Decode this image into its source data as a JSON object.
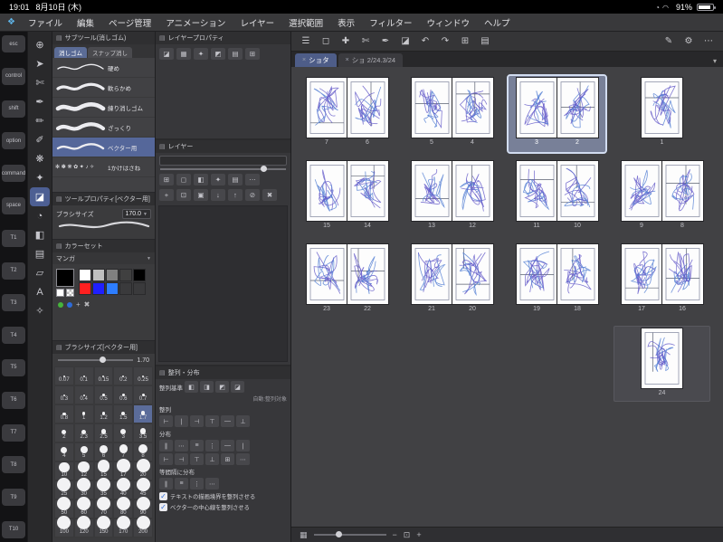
{
  "status_bar": {
    "time": "19:01",
    "date": "8月10日 (木)",
    "battery": "91%",
    "icons": [
      {
        "name": "rotation-lock-icon",
        "glyph": "◔"
      },
      {
        "name": "wifi-icon",
        "glyph": "◠"
      }
    ]
  },
  "menu": {
    "logo": "❖",
    "items": [
      "ファイル",
      "編集",
      "ページ管理",
      "アニメーション",
      "レイヤー",
      "選択範囲",
      "表示",
      "フィルター",
      "ウィンドウ",
      "ヘルプ"
    ]
  },
  "left_rail": {
    "keys": [
      "esc",
      "control",
      "shift",
      "option",
      "command",
      "space",
      "T1",
      "T2",
      "T3",
      "T4",
      "T5",
      "T6",
      "T7",
      "T8",
      "T9",
      "T10"
    ]
  },
  "toolbar": {
    "tools": [
      {
        "name": "zoom",
        "glyph": "⊕"
      },
      {
        "name": "operation",
        "glyph": "➤"
      },
      {
        "name": "lasso",
        "glyph": "✄"
      },
      {
        "name": "pen",
        "glyph": "✒"
      },
      {
        "name": "pencil",
        "glyph": "✏"
      },
      {
        "name": "brush",
        "glyph": "✐"
      },
      {
        "name": "airbrush",
        "glyph": "❋"
      },
      {
        "name": "decoration",
        "glyph": "✦"
      },
      {
        "name": "eraser",
        "glyph": "◪",
        "selected": true
      },
      {
        "name": "blend",
        "glyph": "◔"
      },
      {
        "name": "fill",
        "glyph": "◧"
      },
      {
        "name": "gradient",
        "glyph": "▤"
      },
      {
        "name": "figure",
        "glyph": "▱"
      },
      {
        "name": "text",
        "glyph": "A"
      },
      {
        "name": "eyedropper",
        "glyph": "✧"
      }
    ]
  },
  "subtool": {
    "title": "サブツール(消しゴム)",
    "tabs": [
      {
        "label": "消しゴム",
        "active": true
      },
      {
        "label": "スナップ消し",
        "active": false
      }
    ],
    "items": [
      {
        "label": "硬め"
      },
      {
        "label": "軟らかめ"
      },
      {
        "label": "練り消しゴム"
      },
      {
        "label": "ざっくり"
      },
      {
        "label": "ベクター用",
        "selected": true
      },
      {
        "label": "1かけはさね",
        "deco": true,
        "deco_glyphs": "✻ ✽ ❋ ✿ ✦ ♪ ✧"
      }
    ]
  },
  "tool_property": {
    "title": "ツールプロパティ[ベクター用]",
    "prop_label": "ブラシサイズ",
    "prop_value": "170.0"
  },
  "color_set": {
    "title": "カラーセット",
    "preset": "マンガ",
    "swatch_rows": [
      [
        "#ffffff",
        "#bfbfbf",
        "#808080",
        "#404040",
        "#000000"
      ],
      [
        "#ff2020",
        "#2020ff",
        "#2d7dff",
        "#3a3a3c",
        "#3a3a3c"
      ]
    ],
    "dots": [
      "#46b43c",
      "#2d6bd8"
    ],
    "current_main": "#000000",
    "current_sub": "#ffffff"
  },
  "brush_size": {
    "title": "ブラシサイズ[ベクター用]",
    "value": "1.70",
    "selected": "1.7",
    "rows": [
      [
        "0.07",
        "0.1",
        "0.15",
        "0.2",
        "0.25"
      ],
      [
        "0.3",
        "0.4",
        "0.5",
        "0.6",
        "0.7"
      ],
      [
        "0.8",
        "1",
        "1.2",
        "1.5",
        "1.7"
      ],
      [
        "2",
        "2.3",
        "2.5",
        "3",
        "3.5"
      ],
      [
        "4",
        "5",
        "6",
        "7",
        "8"
      ],
      [
        "10",
        "12",
        "15",
        "17",
        "20"
      ],
      [
        "25",
        "30",
        "35",
        "40",
        "45"
      ],
      [
        "50",
        "60",
        "70",
        "80",
        "90"
      ],
      [
        "100",
        "120",
        "150",
        "170",
        "200"
      ]
    ]
  },
  "layer_property": {
    "title": "レイヤープロパティ",
    "icons": [
      {
        "name": "border-effect-icon",
        "glyph": "◪"
      },
      {
        "name": "tone-icon",
        "glyph": "▦"
      },
      {
        "name": "extract-line-icon",
        "glyph": "✦"
      },
      {
        "name": "layer-color-icon",
        "glyph": "◩"
      },
      {
        "name": "expression-color-icon",
        "glyph": "▤"
      },
      {
        "name": "grid-icon",
        "glyph": "⊞"
      }
    ]
  },
  "layers_panel": {
    "title": "レイヤー",
    "row1": [
      {
        "name": "blend-mode-icon",
        "glyph": "⊞"
      },
      {
        "name": "lock-icon",
        "glyph": "◻"
      },
      {
        "name": "clip-icon",
        "glyph": "◧"
      },
      {
        "name": "effect-icon",
        "glyph": "✦"
      },
      {
        "name": "palette-icon",
        "glyph": "▤"
      },
      {
        "name": "more-icon",
        "glyph": "⋯"
      }
    ],
    "row2": [
      {
        "name": "new-layer-icon",
        "glyph": "+"
      },
      {
        "name": "new-folder-icon",
        "glyph": "⊡"
      },
      {
        "name": "duplicate-icon",
        "glyph": "▣"
      },
      {
        "name": "merge-down-icon",
        "glyph": "↓"
      },
      {
        "name": "move-up-icon",
        "glyph": "↑"
      },
      {
        "name": "transfer-icon",
        "glyph": "⊘"
      },
      {
        "name": "delete-icon",
        "glyph": "✖"
      }
    ]
  },
  "align_panel": {
    "title": "整列・分布",
    "basis_label": "整列基準",
    "basis_icons": [
      {
        "name": "basis-canvas-icon",
        "glyph": "◧"
      },
      {
        "name": "basis-selection-icon",
        "glyph": "◨"
      },
      {
        "name": "basis-object-icon",
        "glyph": "◩"
      },
      {
        "name": "basis-frame-icon",
        "glyph": "◪"
      }
    ],
    "auto_label": "自動:整列対象",
    "align_label": "整列",
    "align_icons": [
      {
        "name": "align-left-icon",
        "glyph": "⊢"
      },
      {
        "name": "align-hcenter-icon",
        "glyph": "∣"
      },
      {
        "name": "align-right-icon",
        "glyph": "⊣"
      },
      {
        "name": "align-top-icon",
        "glyph": "⊤"
      },
      {
        "name": "align-vcenter-icon",
        "glyph": "—"
      },
      {
        "name": "align-bottom-icon",
        "glyph": "⊥"
      }
    ],
    "distribute_label": "分布",
    "distribute_rows": [
      [
        {
          "name": "dist-left-icon",
          "glyph": "∥"
        },
        {
          "name": "dist-hcenter-icon",
          "glyph": "⋯"
        },
        {
          "name": "dist-right-icon",
          "glyph": "≡"
        },
        {
          "name": "dist-top-icon",
          "glyph": "⋮"
        },
        {
          "name": "dist-vcenter-icon",
          "glyph": "—"
        },
        {
          "name": "dist-bottom-icon",
          "glyph": "∣"
        }
      ],
      [
        {
          "name": "dist-h-gap-icon",
          "glyph": "⊢"
        },
        {
          "name": "dist-v-gap-icon",
          "glyph": "⊣"
        },
        {
          "name": "dist-h-even-icon",
          "glyph": "⊤"
        },
        {
          "name": "dist-v-even-icon",
          "glyph": "⊥"
        },
        {
          "name": "dist-grid-icon",
          "glyph": "⊞"
        },
        {
          "name": "dist-more-icon",
          "glyph": "⋯"
        }
      ]
    ],
    "equal_label": "等間隔に分布",
    "equal_icons": [
      {
        "name": "equal-h-icon",
        "glyph": "∥"
      },
      {
        "name": "equal-v-icon",
        "glyph": "≡"
      },
      {
        "name": "equal-hs-icon",
        "glyph": "⋮"
      },
      {
        "name": "equal-vs-icon",
        "glyph": "⋯"
      }
    ],
    "check_glyph": "✓",
    "checkbox_label": "テキストの描画境界を整列させる",
    "checkbox2_label": "ベクターの中心線を整列させる"
  },
  "command_bar": {
    "left": [
      {
        "name": "menu-icon",
        "glyph": "☰"
      },
      {
        "name": "selection-icon",
        "glyph": "◻"
      },
      {
        "name": "move-icon",
        "glyph": "✚"
      },
      {
        "name": "lasso-icon",
        "glyph": "✄"
      },
      {
        "name": "pen-icon",
        "glyph": "✒"
      },
      {
        "name": "eraser-icon",
        "glyph": "◪"
      },
      {
        "name": "undo-icon",
        "glyph": "↶"
      },
      {
        "name": "redo-icon",
        "glyph": "↷"
      },
      {
        "name": "transform-icon",
        "glyph": "⊞"
      },
      {
        "name": "material-icon",
        "glyph": "▤"
      }
    ],
    "right": [
      {
        "name": "edit-icon",
        "glyph": "✎"
      },
      {
        "name": "settings-icon",
        "glyph": "⚙"
      },
      {
        "name": "more-icon",
        "glyph": "⋯"
      }
    ]
  },
  "page_manager": {
    "tabs": [
      {
        "label": "ショタ",
        "active": true
      },
      {
        "label": "ショ 2/24.3/24",
        "active": false
      }
    ],
    "close_glyph": "×",
    "chevron_glyph": "▾",
    "rows": [
      [
        {
          "pages": [
            "7",
            "6"
          ]
        },
        {
          "pages": [
            "5",
            "4"
          ]
        },
        {
          "pages": [
            "3",
            "2"
          ],
          "selected": true
        },
        {
          "pages": [
            "1"
          ]
        }
      ],
      [
        {
          "pages": [
            "15",
            "14"
          ]
        },
        {
          "pages": [
            "13",
            "12"
          ]
        },
        {
          "pages": [
            "11",
            "10"
          ]
        },
        {
          "pages": [
            "9",
            "8"
          ]
        }
      ],
      [
        {
          "pages": [
            "23",
            "22"
          ]
        },
        {
          "pages": [
            "21",
            "20"
          ]
        },
        {
          "pages": [
            "19",
            "18"
          ]
        },
        {
          "pages": [
            "17",
            "16"
          ]
        }
      ],
      [
        null,
        null,
        null,
        {
          "pages": [
            "24"
          ],
          "framed": true
        }
      ]
    ]
  },
  "bottom_bar": {
    "icons_left": [
      {
        "name": "page-list-icon",
        "glyph": "▦"
      }
    ],
    "icons_right": [
      {
        "name": "zoom-out-icon",
        "glyph": "−"
      },
      {
        "name": "fit-screen-icon",
        "glyph": "⊡"
      },
      {
        "name": "zoom-in-icon",
        "glyph": "+"
      }
    ]
  }
}
